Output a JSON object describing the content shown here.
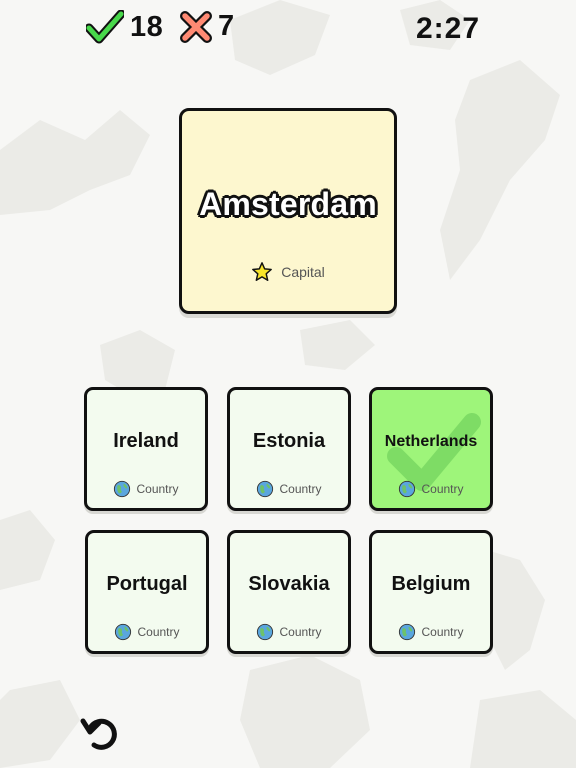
{
  "score": {
    "correct": "18",
    "wrong": "7"
  },
  "timer": "2:27",
  "prompt": {
    "title": "Amsterdam",
    "tag": "Capital"
  },
  "answers": [
    {
      "name": "Ireland",
      "tag": "Country"
    },
    {
      "name": "Estonia",
      "tag": "Country"
    },
    {
      "name": "Netherlands",
      "tag": "Country"
    },
    {
      "name": "Portugal",
      "tag": "Country"
    },
    {
      "name": "Slovakia",
      "tag": "Country"
    },
    {
      "name": "Belgium",
      "tag": "Country"
    }
  ],
  "colors": {
    "correct_card": "#9ef57a",
    "card": "#f3fbef",
    "prompt_card": "#fdf7cf",
    "check": "#48d84b",
    "cross": "#ff8a73"
  },
  "icons": {
    "score_correct": "check-icon",
    "score_wrong": "cross-icon",
    "prompt_tag": "star-icon",
    "answer_tag": "globe-icon",
    "undo": "undo-icon"
  }
}
